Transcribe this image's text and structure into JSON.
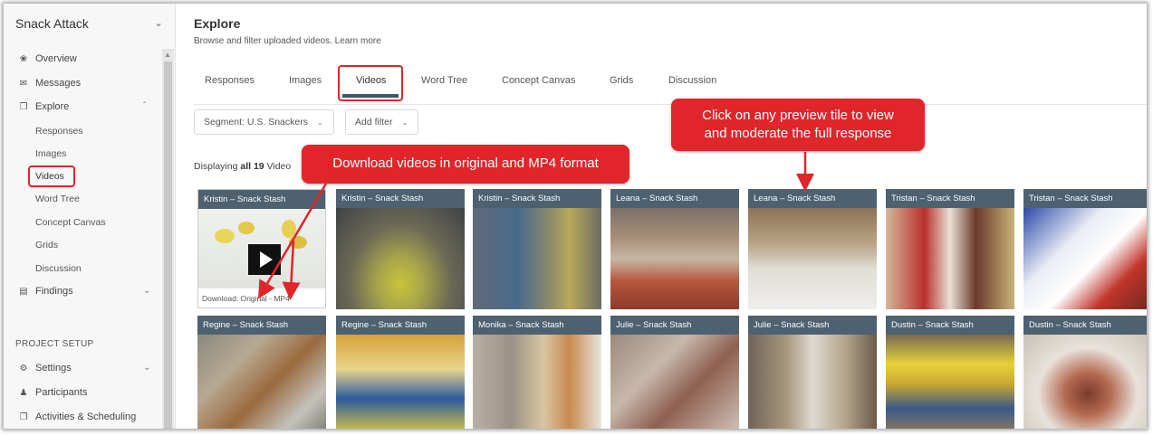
{
  "project": {
    "name": "Snack Attack"
  },
  "sidebar": {
    "items": [
      {
        "label": "Overview",
        "icon": "dashboard-icon"
      },
      {
        "label": "Messages",
        "icon": "mail-icon"
      },
      {
        "label": "Explore",
        "icon": "copy-icon"
      }
    ],
    "explore_children": [
      "Responses",
      "Images",
      "Videos",
      "Word Tree",
      "Concept Canvas",
      "Grids",
      "Discussion"
    ],
    "findings": {
      "label": "Findings",
      "icon": "bar-chart-icon"
    },
    "section_label": "PROJECT SETUP",
    "setup_items": [
      {
        "label": "Settings",
        "icon": "gear-icon"
      },
      {
        "label": "Participants",
        "icon": "person-icon"
      },
      {
        "label": "Activities & Scheduling",
        "icon": "copy-icon"
      }
    ]
  },
  "main": {
    "title": "Explore",
    "subtitle": "Browse and filter uploaded videos. Learn more",
    "tabs": [
      "Responses",
      "Images",
      "Videos",
      "Word Tree",
      "Concept Canvas",
      "Grids",
      "Discussion"
    ],
    "active_tab": "Videos",
    "filters": {
      "segment": "Segment: U.S. Snackers",
      "add_filter": "Add filter"
    },
    "display_prefix": "Displaying ",
    "display_count": "all 19",
    "display_suffix": " Video"
  },
  "tiles": [
    {
      "label": "Kristin – Snack Stash",
      "download": "Download: Original - MP4"
    },
    {
      "label": "Kristin – Snack Stash"
    },
    {
      "label": "Kristin – Snack Stash"
    },
    {
      "label": "Leana – Snack Stash"
    },
    {
      "label": "Leana – Snack Stash"
    },
    {
      "label": "Tristan – Snack Stash"
    },
    {
      "label": "Tristan – Snack Stash"
    },
    {
      "label": "Regine – Snack Stash"
    },
    {
      "label": "Regine – Snack Stash"
    },
    {
      "label": "Monika – Snack Stash"
    },
    {
      "label": "Julie – Snack Stash"
    },
    {
      "label": "Julie – Snack Stash"
    },
    {
      "label": "Dustin – Snack Stash"
    },
    {
      "label": "Dustin – Snack Stash"
    }
  ],
  "callouts": {
    "download": "Download videos in original and MP4 format",
    "preview_line1": "Click on any preview tile to view",
    "preview_line2": "and moderate the full response"
  },
  "colors": {
    "accent_red": "#e0262a",
    "tile_header": "#4d6170",
    "tab_underline": "#445566"
  }
}
